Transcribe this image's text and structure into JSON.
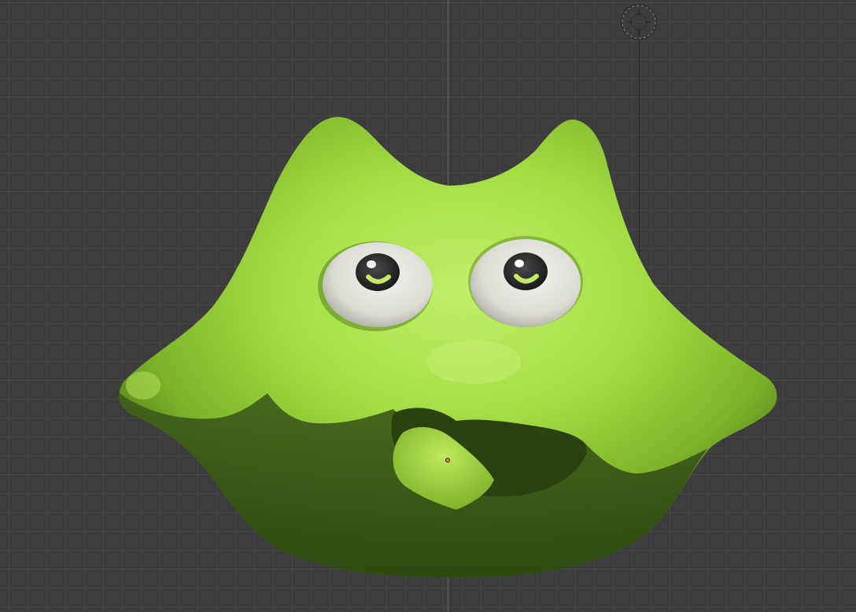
{
  "viewport": {
    "name": "3D Viewport",
    "background_color": "#3d3d3d",
    "grid_color": "#474747",
    "axis_color": "#3e6fb0"
  },
  "scene": {
    "object": "green-blob-creature",
    "body_color": "#9fd63a",
    "shadow_color": "#344f14",
    "eye_white": "#e8e8e2",
    "pupil_color": "#2a2a2a",
    "iris_accent": "#c6e86a",
    "origin_color": "#e0803a"
  },
  "icons": {
    "cursor": "3d-cursor-icon",
    "origin": "object-origin-icon"
  }
}
